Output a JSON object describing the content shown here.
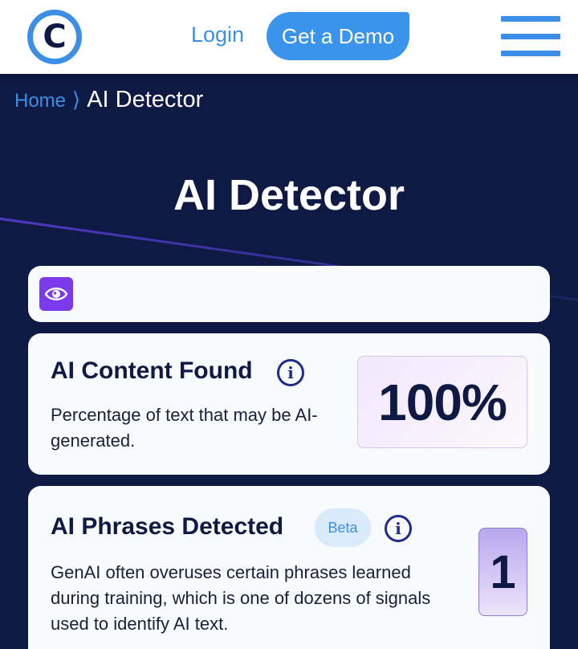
{
  "header": {
    "logo_letter": "C",
    "login_label": "Login",
    "demo_label": "Get a Demo"
  },
  "breadcrumb": {
    "home": "Home",
    "separator": "⟩",
    "current": "AI Detector"
  },
  "page_title": "AI Detector",
  "ai_content": {
    "title": "AI Content Found",
    "description": "Percentage of text that may be AI-generated.",
    "value": "100%"
  },
  "ai_phrases": {
    "title": "AI Phrases Detected",
    "badge": "Beta",
    "description": "GenAI often overuses certain phrases learned during training, which is one of dozens of signals used to identify AI text.",
    "count": "1"
  },
  "icons": {
    "logo": "copyleaks-c-logo",
    "menu": "hamburger-menu-icon",
    "eye": "eye-icon",
    "info": "info-icon"
  },
  "colors": {
    "accent": "#3d8ee6",
    "background": "#0f1a44",
    "card": "#f7fbfd",
    "purple": "#7c3aed"
  }
}
